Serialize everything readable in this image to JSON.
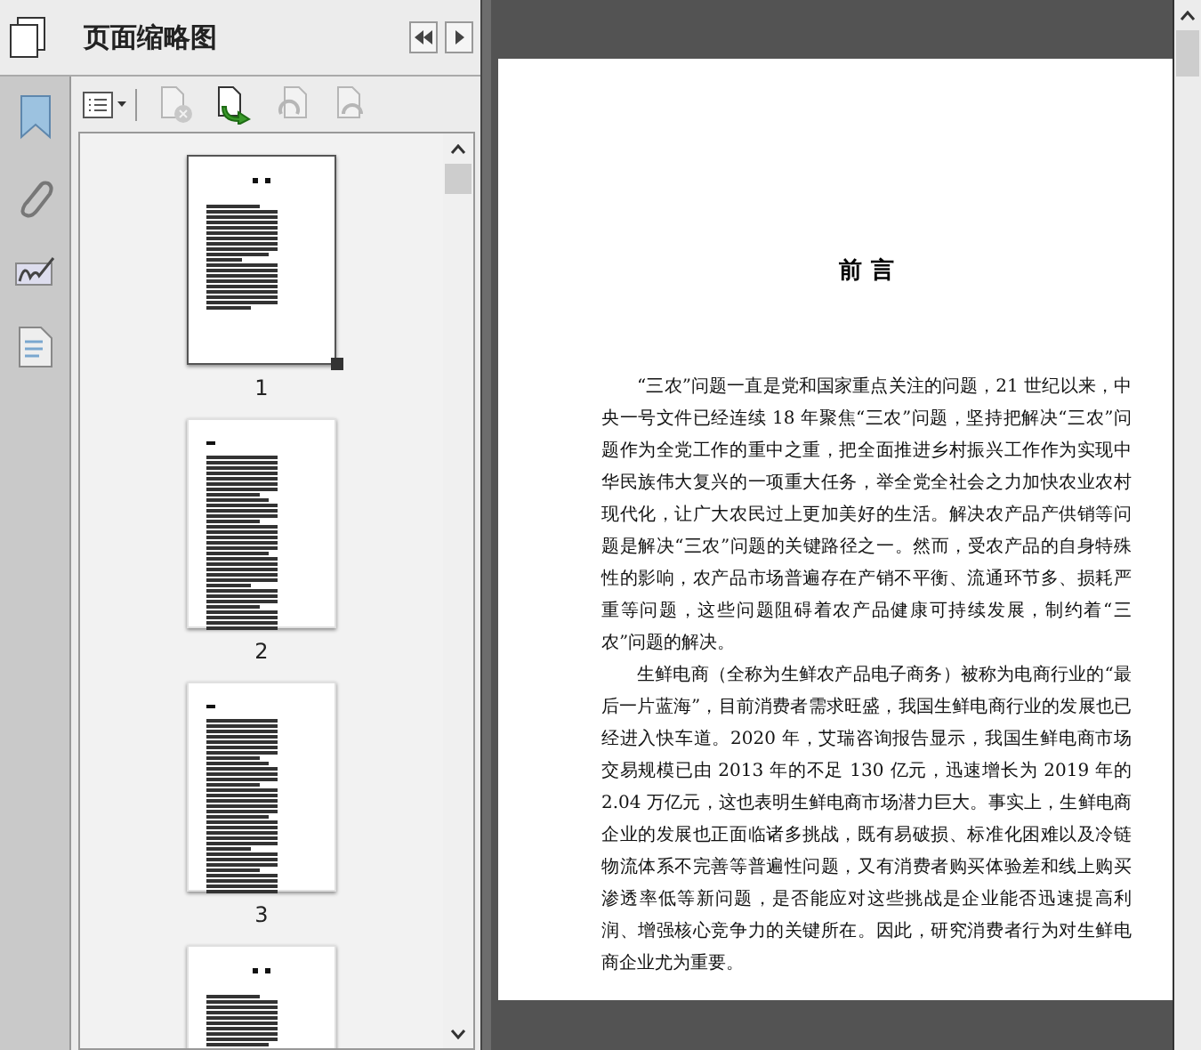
{
  "panel": {
    "title": "页面缩略图"
  },
  "tools": [
    {
      "kind": "options",
      "disabled": false
    },
    {
      "kind": "delete",
      "disabled": true
    },
    {
      "kind": "insert",
      "disabled": false
    },
    {
      "kind": "rotate-left",
      "disabled": true
    },
    {
      "kind": "rotate-right",
      "disabled": true
    }
  ],
  "thumbnails": [
    {
      "kind": "title-page",
      "label": "1",
      "selected": true
    },
    {
      "kind": "text",
      "label": "2",
      "selected": false
    },
    {
      "kind": "text",
      "label": "3",
      "selected": false
    },
    {
      "kind": "title-page",
      "selected": false
    }
  ],
  "document": {
    "heading": "前 言",
    "paragraphs": [
      "“三农”问题一直是党和国家重点关注的问题，21 世纪以来，中央一号文件已经连续 18 年聚焦“三农”问题，坚持把解决“三农”问题作为全党工作的重中之重，把全面推进乡村振兴工作作为实现中华民族伟大复兴的一项重大任务，举全党全社会之力加快农业农村现代化，让广大农民过上更加美好的生活。解决农产品产供销等问题是解决“三农”问题的关键路径之一。然而，受农产品的自身特殊性的影响，农产品市场普遍存在产销不平衡、流通环节多、损耗严重等问题，这些问题阻碍着农产品健康可持续发展，制约着“三农”问题的解决。",
      "生鲜电商（全称为生鲜农产品电子商务）被称为电商行业的“最后一片蓝海”，目前消费者需求旺盛，我国生鲜电商行业的发展也已经进入快车道。2020 年，艾瑞咨询报告显示，我国生鲜电商市场交易规模已由 2013 年的不足 130 亿元，迅速增长为 2019 年的 2.04 万亿元，这也表明生鲜电商市场潜力巨大。事实上，生鲜电商企业的发展也正面临诸多挑战，既有易破损、标准化困难以及冷链物流体系不完善等普遍性问题，又有消费者购买体验差和线上购买渗透率低等新问题，是否能应对这些挑战是企业能否迅速提高利润、增强核心竞争力的关键所在。因此，研究消费者行为对生鲜电商企业尤为重要。"
    ]
  }
}
